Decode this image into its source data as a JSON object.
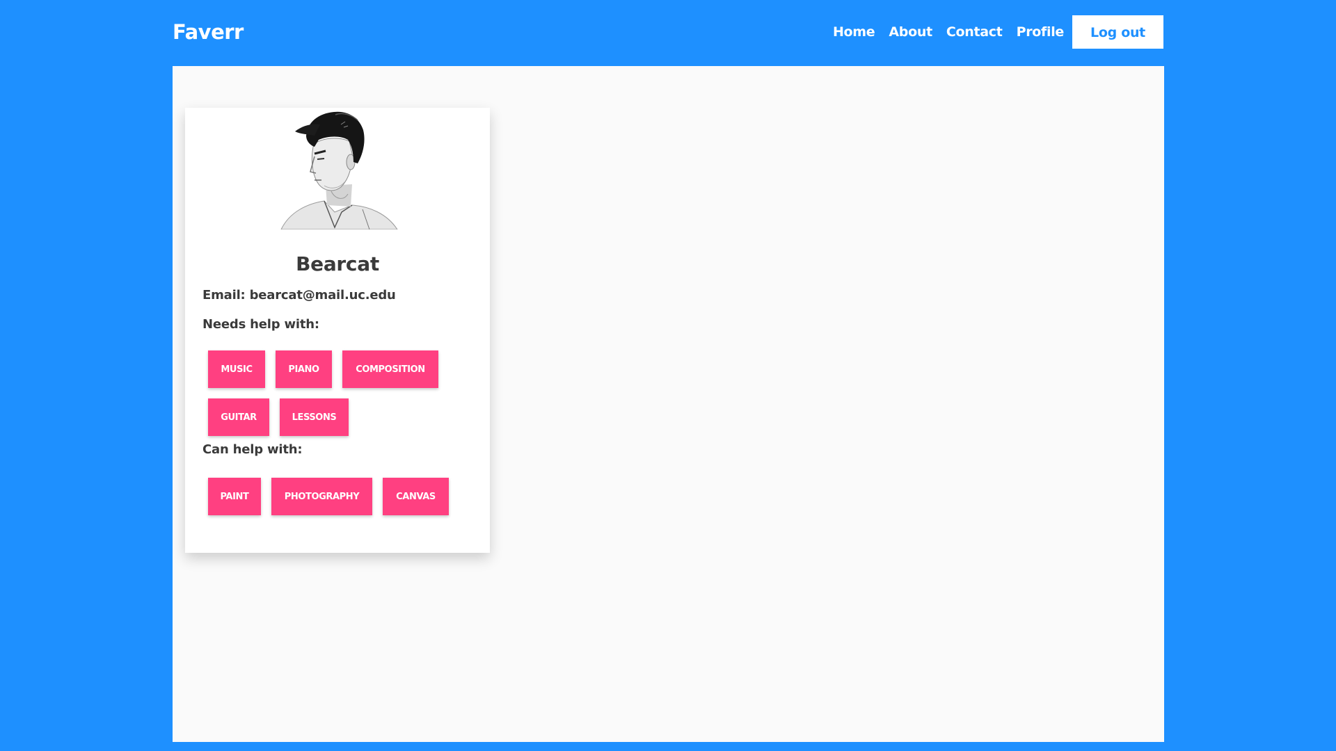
{
  "navbar": {
    "brand": "Faverr",
    "links": [
      "Home",
      "About",
      "Contact",
      "Profile"
    ],
    "logout_label": "Log out"
  },
  "profile": {
    "name": "Bearcat",
    "email_line": "Email: bearcat@mail.uc.edu",
    "needs_help_label": "Needs help with:",
    "needs_help_tags": [
      "MUSIC",
      "PIANO",
      "COMPOSITION",
      "GUITAR",
      "LESSONS"
    ],
    "can_help_label": "Can help with:",
    "can_help_tags": [
      "PAINT",
      "PHOTOGRAPHY",
      "CANVAS"
    ]
  },
  "colors": {
    "primary": "#1e90ff",
    "tag": "#ff4081",
    "text": "#3a3a3a",
    "panel": "#fafafa"
  }
}
